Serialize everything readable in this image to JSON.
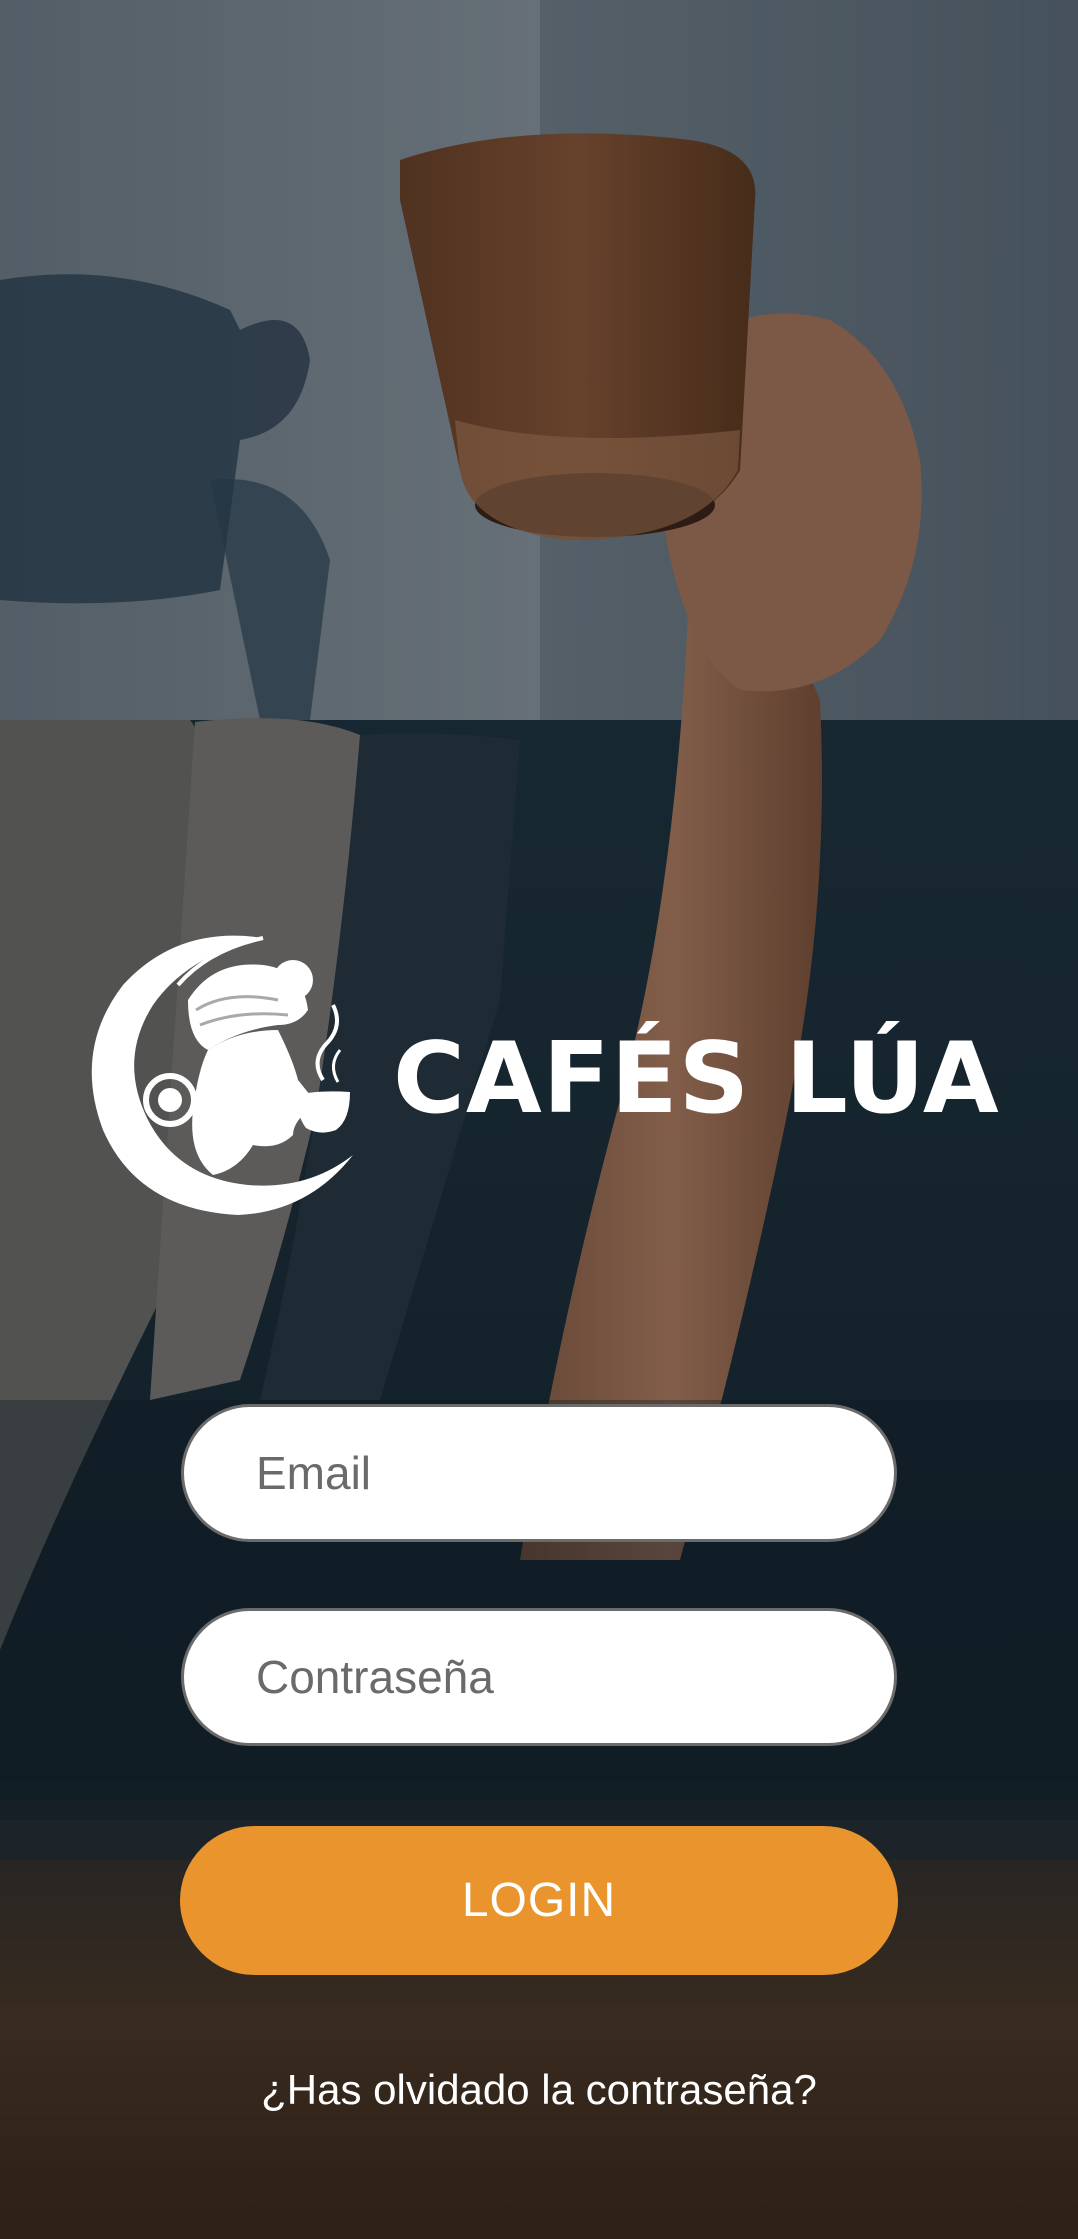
{
  "brand": {
    "name": "CAFÉS LÚA"
  },
  "form": {
    "email_placeholder": "Email",
    "password_placeholder": "Contraseña",
    "login_label": "LOGIN",
    "forgot_label": "¿Has olvidado la contraseña?"
  },
  "colors": {
    "accent": "#e9942d",
    "field_bg": "#ffffff",
    "text_light": "#ffffff"
  }
}
